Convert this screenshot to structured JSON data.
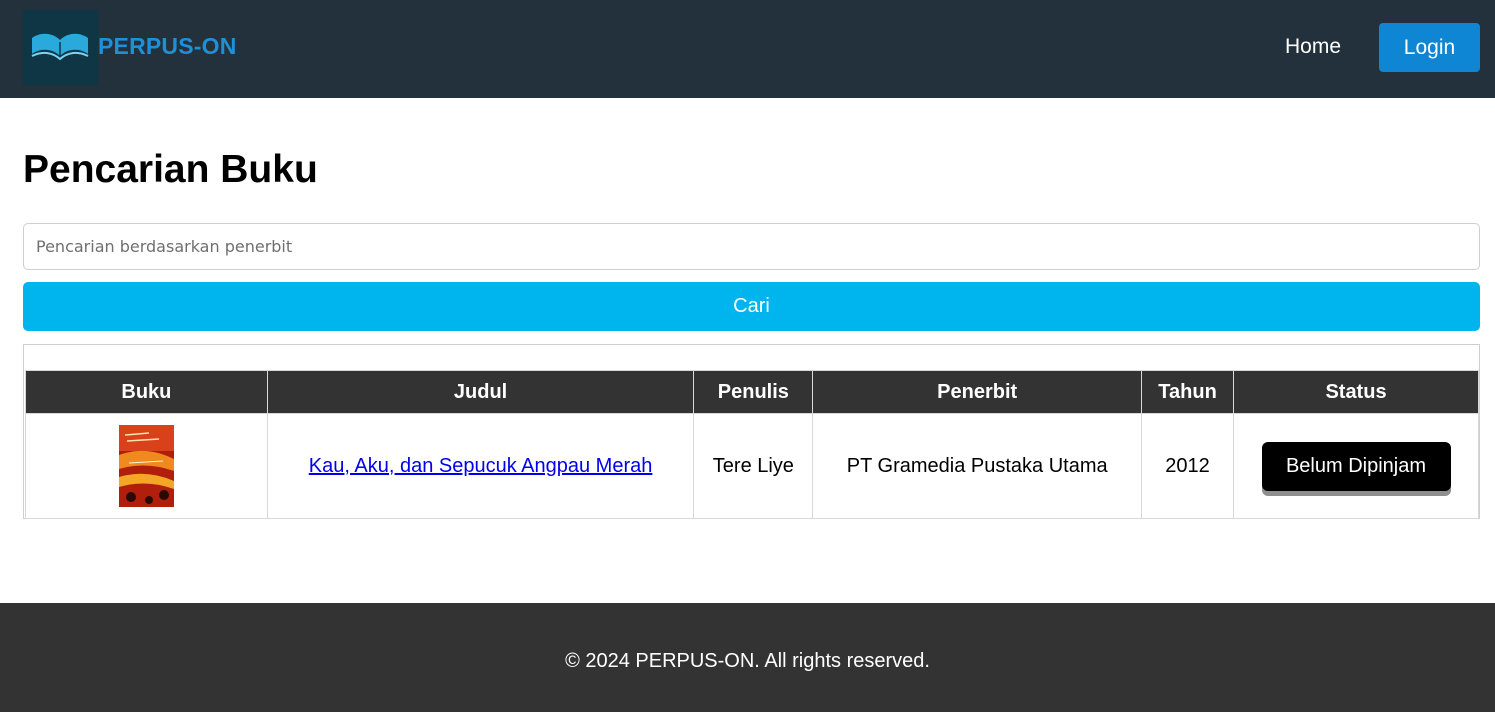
{
  "header": {
    "brand": "PERPUS-ON",
    "logo_icon": "open-book-icon",
    "nav_home": "Home",
    "login_label": "Login",
    "colors": {
      "bar": "#22313b",
      "brand": "#1f8fd6",
      "login": "#0e86d4"
    }
  },
  "main": {
    "title": "Pencarian Buku",
    "search": {
      "placeholder": "Pencarian berdasarkan penerbit",
      "value": ""
    },
    "search_button": "Cari",
    "table": {
      "headers": [
        "Buku",
        "Judul",
        "Penulis",
        "Penerbit",
        "Tahun",
        "Status"
      ],
      "rows": [
        {
          "cover_icon": "book-cover-image",
          "title": "Kau, Aku, dan Sepucuk Angpau Merah",
          "author": "Tere Liye",
          "publisher": "PT Gramedia Pustaka Utama",
          "year": "2012",
          "status": "Belum Dipinjam"
        }
      ]
    },
    "colors": {
      "search_button": "#00b5ed",
      "table_header": "#333333",
      "status": "#000000"
    }
  },
  "footer": {
    "text": "© 2024 PERPUS-ON. All rights reserved."
  }
}
